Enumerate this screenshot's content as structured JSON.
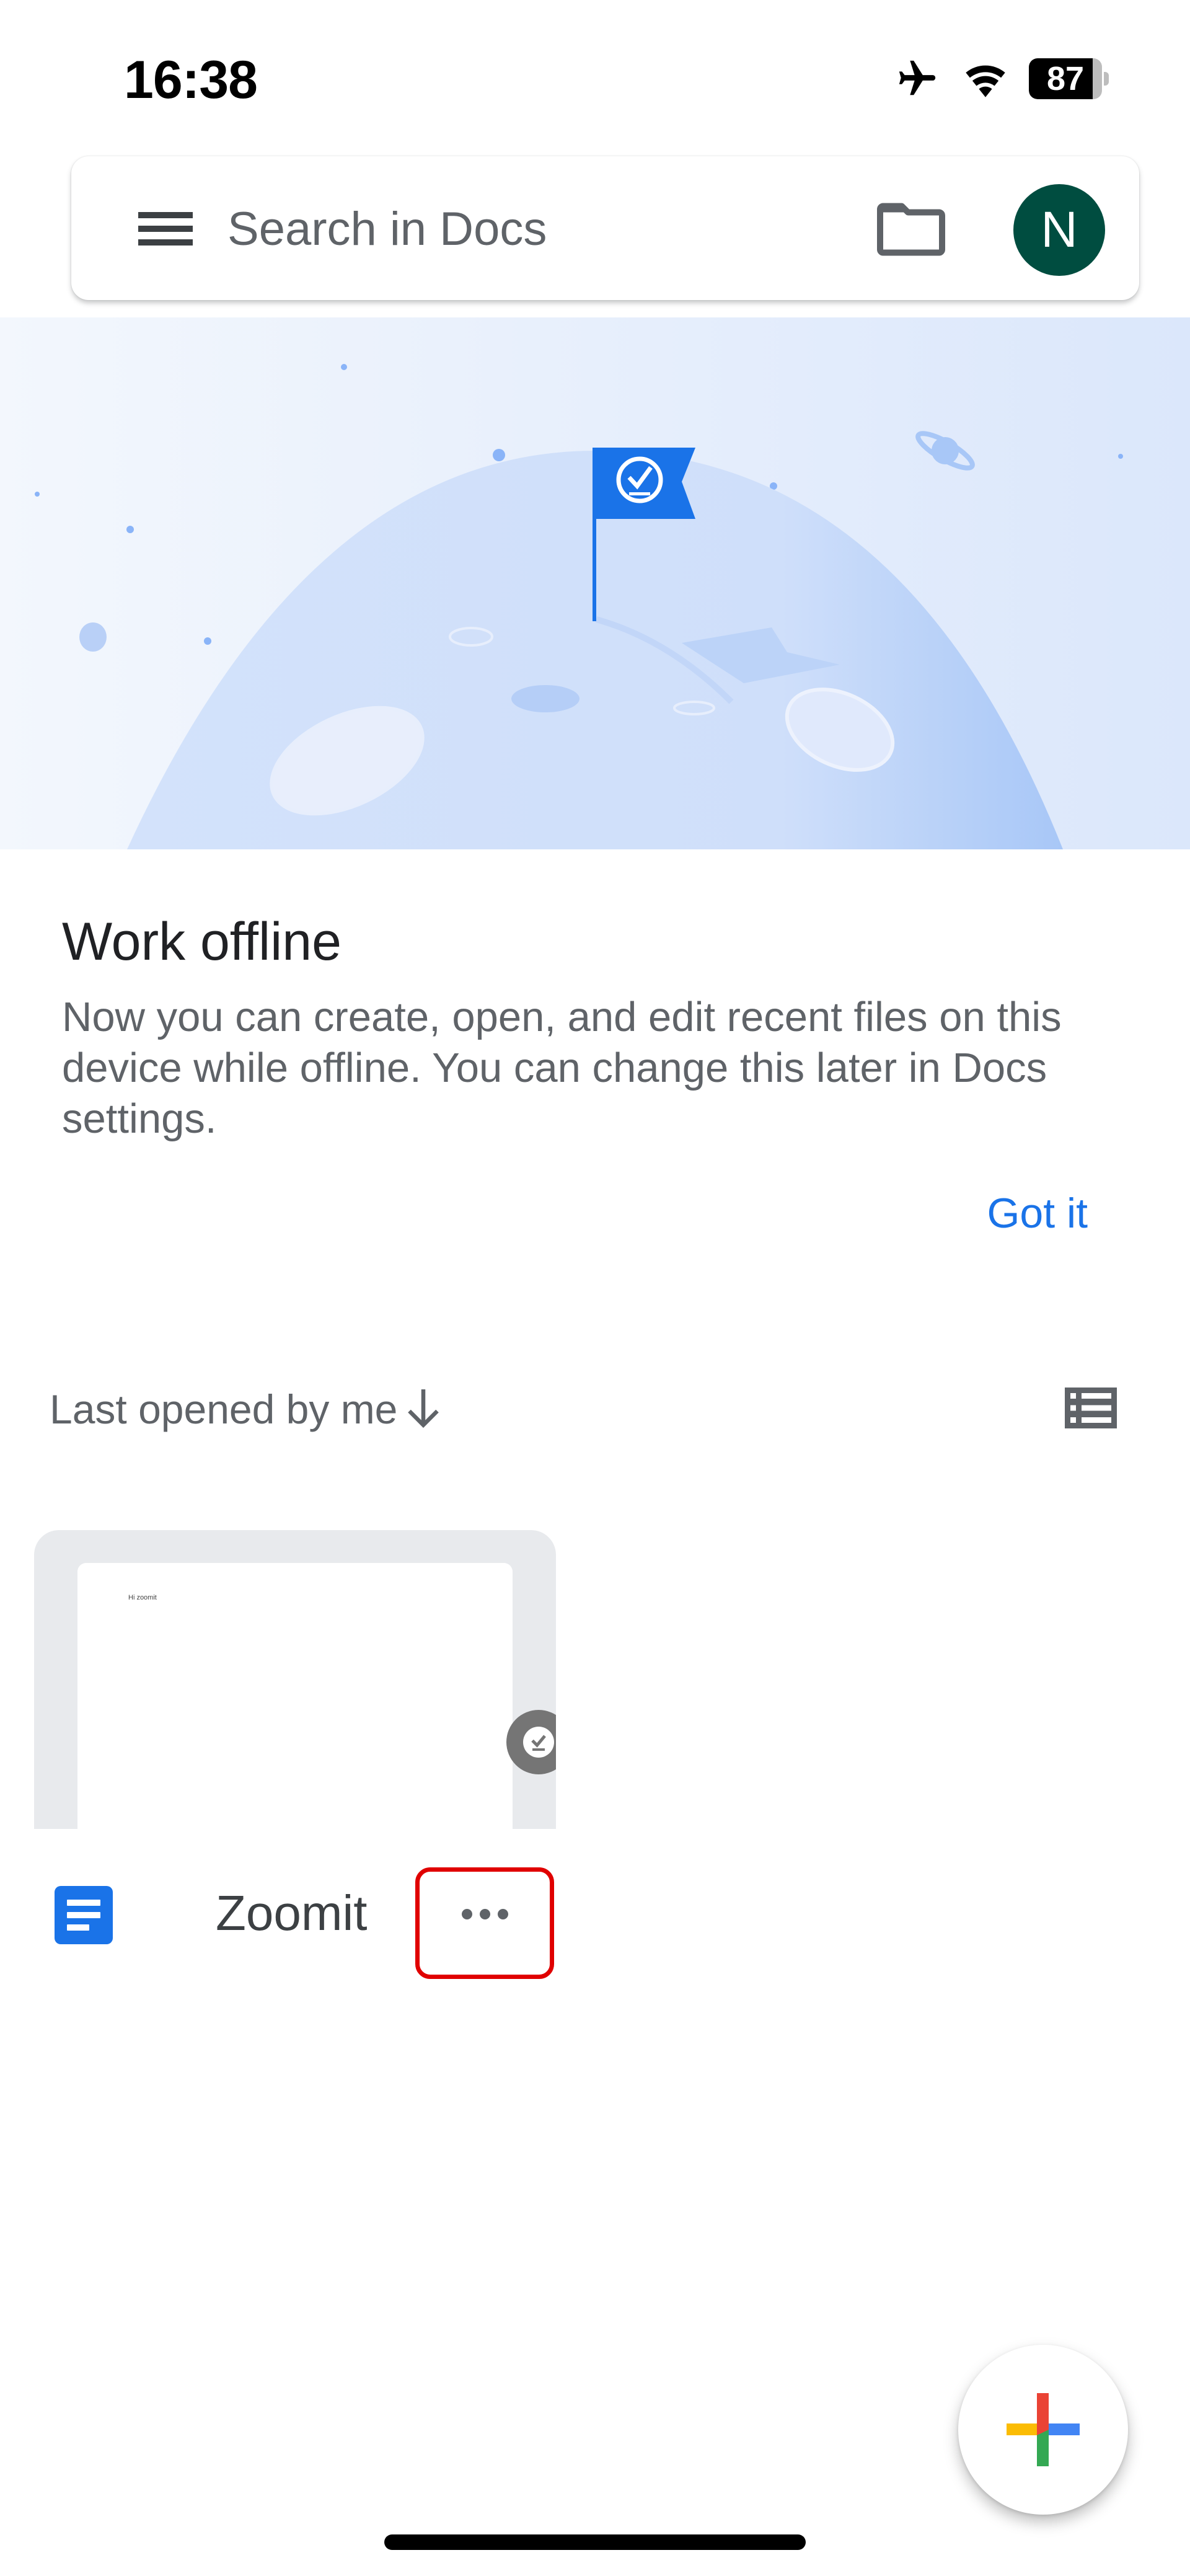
{
  "status_bar": {
    "time": "16:38",
    "icons": [
      "airplane-mode-icon",
      "wifi-icon",
      "battery-icon"
    ],
    "battery_percent": 87
  },
  "search": {
    "placeholder": "Search in Docs",
    "value": "",
    "menu_icon": "hamburger-menu-icon",
    "folder_icon": "folder-icon",
    "avatar_initial": "N",
    "avatar_color": "#004d40"
  },
  "banner": {
    "illustration": "moon-with-offline-flag",
    "flag_icon": "offline-check-icon"
  },
  "offline_card": {
    "title": "Work offline",
    "body": "Now you can create, open, and edit recent files on this device while offline. You can change this later in Docs settings.",
    "action_label": "Got it",
    "accent_color": "#1a73e8"
  },
  "files_section": {
    "sort_label": "Last opened by me",
    "sort_direction_icon": "arrow-down-icon",
    "view_toggle_icon": "list-view-icon",
    "files": [
      {
        "name": "Zoomit",
        "preview_text": "Hi zoomit",
        "type_icon": "google-docs-icon",
        "available_offline": true,
        "more_icon": "more-horizontal-icon"
      }
    ],
    "highlight_color": "#e00000"
  },
  "fab": {
    "icon": "create-plus-icon",
    "colors": {
      "top": "#ea4335",
      "right": "#4285f4",
      "bottom": "#34a853",
      "left": "#fbbc04"
    }
  }
}
